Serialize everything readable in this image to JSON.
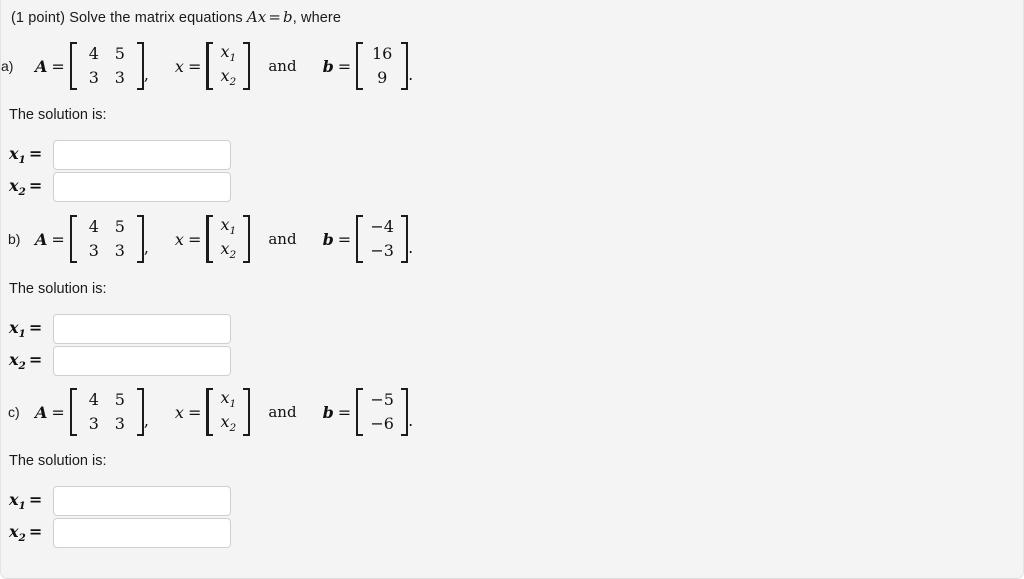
{
  "question": {
    "points_prefix": "(1 point)",
    "prompt_lead": "Solve the matrix equations",
    "prompt_math_A": "A",
    "prompt_math_x": "x",
    "prompt_equals": "=",
    "prompt_math_b": "b",
    "prompt_tail": ", where"
  },
  "symbols": {
    "A": "A",
    "x": "x",
    "b": "b",
    "equals": "=",
    "and": "and",
    "comma": ",",
    "period": "."
  },
  "solution_heading": "The solution is:",
  "answer_labels": {
    "x1_var": "x",
    "x1_sub": "1",
    "x2_var": "x",
    "x2_sub": "2",
    "equals": "="
  },
  "input_placeholder": "",
  "parts": [
    {
      "label": "a)",
      "matrix_A": [
        [
          "4",
          "5"
        ],
        [
          "3",
          "3"
        ]
      ],
      "vector_x": [
        {
          "var": "x",
          "sub": "1"
        },
        {
          "var": "x",
          "sub": "2"
        }
      ],
      "vector_b": [
        "16",
        "9"
      ],
      "solution_heading": "The solution is:",
      "answers": {
        "x1_value": "",
        "x2_value": ""
      }
    },
    {
      "label": "b)",
      "matrix_A": [
        [
          "4",
          "5"
        ],
        [
          "3",
          "3"
        ]
      ],
      "vector_x": [
        {
          "var": "x",
          "sub": "1"
        },
        {
          "var": "x",
          "sub": "2"
        }
      ],
      "vector_b": [
        "−4",
        "−3"
      ],
      "solution_heading": "The solution is:",
      "answers": {
        "x1_value": "",
        "x2_value": ""
      }
    },
    {
      "label": "c)",
      "matrix_A": [
        [
          "4",
          "5"
        ],
        [
          "3",
          "3"
        ]
      ],
      "vector_x": [
        {
          "var": "x",
          "sub": "1"
        },
        {
          "var": "x",
          "sub": "2"
        }
      ],
      "vector_b": [
        "−5",
        "−6"
      ],
      "solution_heading": "The solution is:",
      "answers": {
        "x1_value": "",
        "x2_value": ""
      }
    }
  ],
  "colors": {
    "page_background": "#f4f4f4",
    "text": "#1a1a1a",
    "input_background": "#ffffff",
    "input_border": "#cfcfcf",
    "card_border": "#dcdcdc"
  }
}
